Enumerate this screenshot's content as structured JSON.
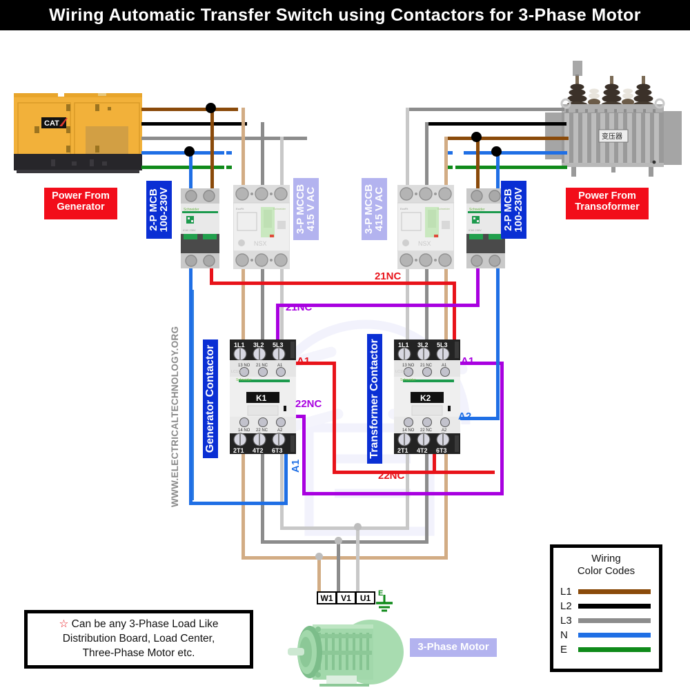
{
  "title": "Wiring Automatic Transfer Switch using Contactors for 3-Phase Motor",
  "watermark": {
    "url": "WWW.ELECTRICALTECHNOLOGY.ORG"
  },
  "sources": {
    "generator": {
      "label_line1": "Power From",
      "label_line2": "Generator",
      "brand": "CAT"
    },
    "transformer": {
      "label_line1": "Power From",
      "label_line2": "Transoformer",
      "brand": "变压器"
    }
  },
  "breakers": {
    "gen_mcb": {
      "line1": "2-P MCB",
      "line2": "100-230V"
    },
    "gen_mccb": {
      "line1": "3-P MCCB",
      "line2": "415 V AC"
    },
    "tr_mccb": {
      "line1": "3-P MCCB",
      "line2": "415 V AC"
    },
    "tr_mcb": {
      "line1": "2-P MCB",
      "line2": "100-230V"
    },
    "brand": "Schneider"
  },
  "contactors": {
    "generator": {
      "side_label": "Generator Contactor",
      "tag": "K1",
      "top_terminals": [
        "1L1",
        "3L2",
        "5L3"
      ],
      "aux_top": [
        "13  NO",
        "21  NC",
        "A1"
      ],
      "aux_bottom": [
        "14  NO",
        "22  NC",
        "A2"
      ],
      "bottom_terminals": [
        "2T1",
        "4T2",
        "6T3"
      ],
      "brand": "Schneider",
      "model": "LC1D34"
    },
    "transformer": {
      "side_label": "Transformer Contactor",
      "tag": "K2",
      "top_terminals": [
        "1L1",
        "3L2",
        "5L3"
      ],
      "aux_top": [
        "13  NO",
        "21  NC",
        "A1"
      ],
      "aux_bottom": [
        "14  NO",
        "22  NC",
        "A2"
      ],
      "bottom_terminals": [
        "2T1",
        "4T2",
        "6T3"
      ],
      "brand": "Schneider",
      "model": "LC1D34"
    }
  },
  "wire_labels": {
    "nc21_red": "21NC",
    "nc21_magenta": "21NC",
    "nc22_magenta": "22NC",
    "nc22_red": "22NC",
    "a1_gen_red": "A1",
    "a1_gen_blue": "A1",
    "a1_tr_magenta": "A1",
    "a2_tr_blue": "A2"
  },
  "motor": {
    "label": "3-Phase Motor",
    "terminals": [
      "W1",
      "V1",
      "U1"
    ],
    "earth": "E"
  },
  "legend": {
    "title_line1": "Wiring",
    "title_line2": "Color Codes",
    "rows": [
      {
        "name": "L1",
        "color": "#8a4a0a"
      },
      {
        "name": "L2",
        "color": "#000000"
      },
      {
        "name": "L3",
        "color": "#8c8c8c"
      },
      {
        "name": "N",
        "color": "#1f6fe5"
      },
      {
        "name": "E",
        "color": "#0f8a1a"
      }
    ]
  },
  "note": {
    "star": "☆",
    "line1": "Can be any 3-Phase Load Like",
    "line2": "Distribution Board, Load Center,",
    "line3": "Three-Phase Motor etc."
  },
  "colors": {
    "L1_brown": "#8a4a0a",
    "L2_black": "#000000",
    "L3_gray": "#8c8c8c",
    "N_blue": "#1f6fe5",
    "E_green": "#0f8a1a",
    "control_red": "#e8131a",
    "control_magenta": "#a800e0",
    "load_tan": "#d2ac84",
    "load_darkgray": "#8c8c8c",
    "load_lightgray": "#c8c8c8",
    "accent_blue_box": "#0a2fd4",
    "lilac_box": "#b3b3ef",
    "red_box": "#f20d1a"
  }
}
